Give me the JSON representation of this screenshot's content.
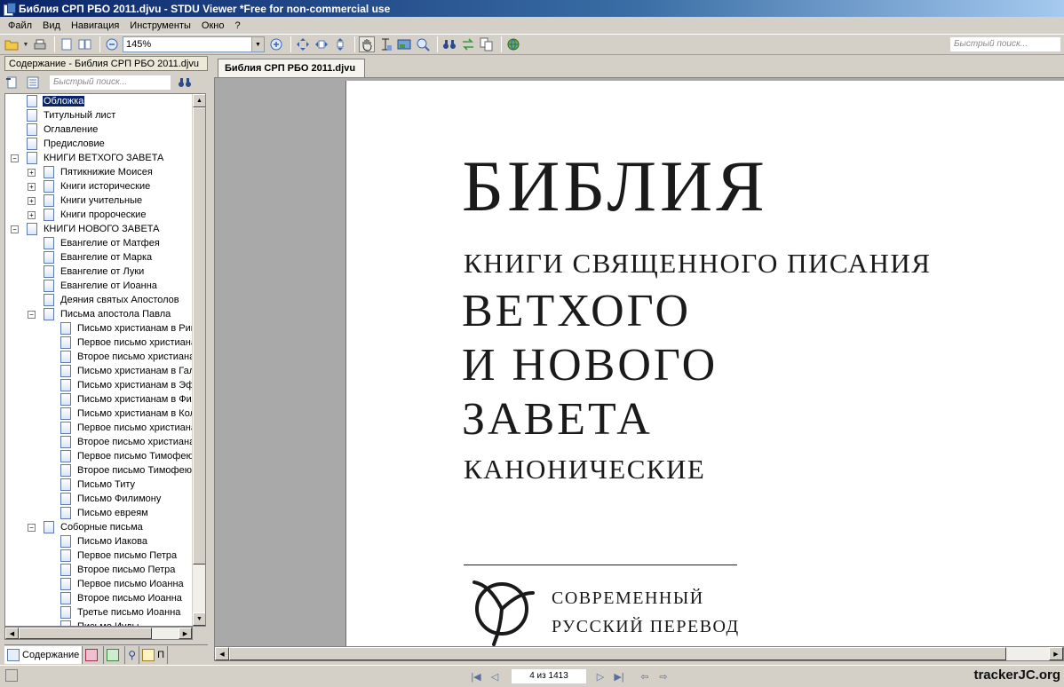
{
  "window": {
    "title": "Библия СРП РБО 2011.djvu - STDU Viewer *Free for non-commercial use"
  },
  "menu": [
    "Файл",
    "Вид",
    "Навигация",
    "Инструменты",
    "Окно",
    "?"
  ],
  "toolbar": {
    "zoom": "145%",
    "quick_search_placeholder": "Быстрый поиск..."
  },
  "sidebar": {
    "title": "Содержание - Библия СРП РБО 2011.djvu",
    "search_placeholder": "Быстрый поиск...",
    "tree": [
      {
        "label": "Обложка",
        "level": 0,
        "selected": true
      },
      {
        "label": "Титульный лист",
        "level": 0
      },
      {
        "label": "Оглавление",
        "level": 0
      },
      {
        "label": "Предисловие",
        "level": 0
      },
      {
        "label": "КНИГИ ВЕТХОГО ЗАВЕТА",
        "level": 0,
        "expander": "−"
      },
      {
        "label": "Пятикнижие Моисея",
        "level": 1,
        "expander": "+"
      },
      {
        "label": "Книги исторические",
        "level": 1,
        "expander": "+"
      },
      {
        "label": "Книги учительные",
        "level": 1,
        "expander": "+"
      },
      {
        "label": "Книги пророческие",
        "level": 1,
        "expander": "+"
      },
      {
        "label": "КНИГИ НОВОГО ЗАВЕТА",
        "level": 0,
        "expander": "−"
      },
      {
        "label": "Евангелие от Матфея",
        "level": 1
      },
      {
        "label": "Евангелие от Марка",
        "level": 1
      },
      {
        "label": "Евангелие от Луки",
        "level": 1
      },
      {
        "label": "Евангелие от Иоанна",
        "level": 1
      },
      {
        "label": "Деяния святых Апостолов",
        "level": 1
      },
      {
        "label": "Письма апостола Павла",
        "level": 1,
        "expander": "−"
      },
      {
        "label": "Письмо христианам в Риме",
        "level": 2
      },
      {
        "label": "Первое письмо христианам",
        "level": 2
      },
      {
        "label": "Второе письмо христианам",
        "level": 2
      },
      {
        "label": "Письмо христианам в Галатии",
        "level": 2
      },
      {
        "label": "Письмо христианам в Эфесе",
        "level": 2
      },
      {
        "label": "Письмо христианам в Филиппах",
        "level": 2
      },
      {
        "label": "Письмо христианам в Колоссах",
        "level": 2
      },
      {
        "label": "Первое письмо христианам",
        "level": 2
      },
      {
        "label": "Второе письмо христианам",
        "level": 2
      },
      {
        "label": "Первое письмо Тимофею",
        "level": 2
      },
      {
        "label": "Второе письмо Тимофею",
        "level": 2
      },
      {
        "label": "Письмо Титу",
        "level": 2
      },
      {
        "label": "Письмо Филимону",
        "level": 2
      },
      {
        "label": "Письмо евреям",
        "level": 2
      },
      {
        "label": "Соборные письма",
        "level": 1,
        "expander": "−"
      },
      {
        "label": "Письмо Иакова",
        "level": 2
      },
      {
        "label": "Первое письмо Петра",
        "level": 2
      },
      {
        "label": "Второе письмо Петра",
        "level": 2
      },
      {
        "label": "Первое письмо Иоанна",
        "level": 2
      },
      {
        "label": "Второе письмо Иоанна",
        "level": 2
      },
      {
        "label": "Третье письмо Иоанна",
        "level": 2
      },
      {
        "label": "Письмо Иуды",
        "level": 2
      }
    ],
    "tabs": {
      "contents": "Содержание",
      "last": "П"
    }
  },
  "document": {
    "tab_title": "Библия СРП РБО 2011.djvu",
    "page": {
      "title": "БИБЛИЯ",
      "subtitle": "КНИГИ СВЯЩЕННОГО ПИСАНИЯ",
      "line1": "ВЕТХОГО",
      "line2": "И НОВОГО",
      "line3": "ЗАВЕТА",
      "canonical": "КАНОНИЧЕСКИЕ",
      "publisher_line1": "СОВРЕМЕННЫЙ",
      "publisher_line2": "РУССКИЙ ПЕРЕВОД"
    }
  },
  "statusbar": {
    "page_indicator": "4 из 1413",
    "watermark": "trackerJC.org"
  }
}
